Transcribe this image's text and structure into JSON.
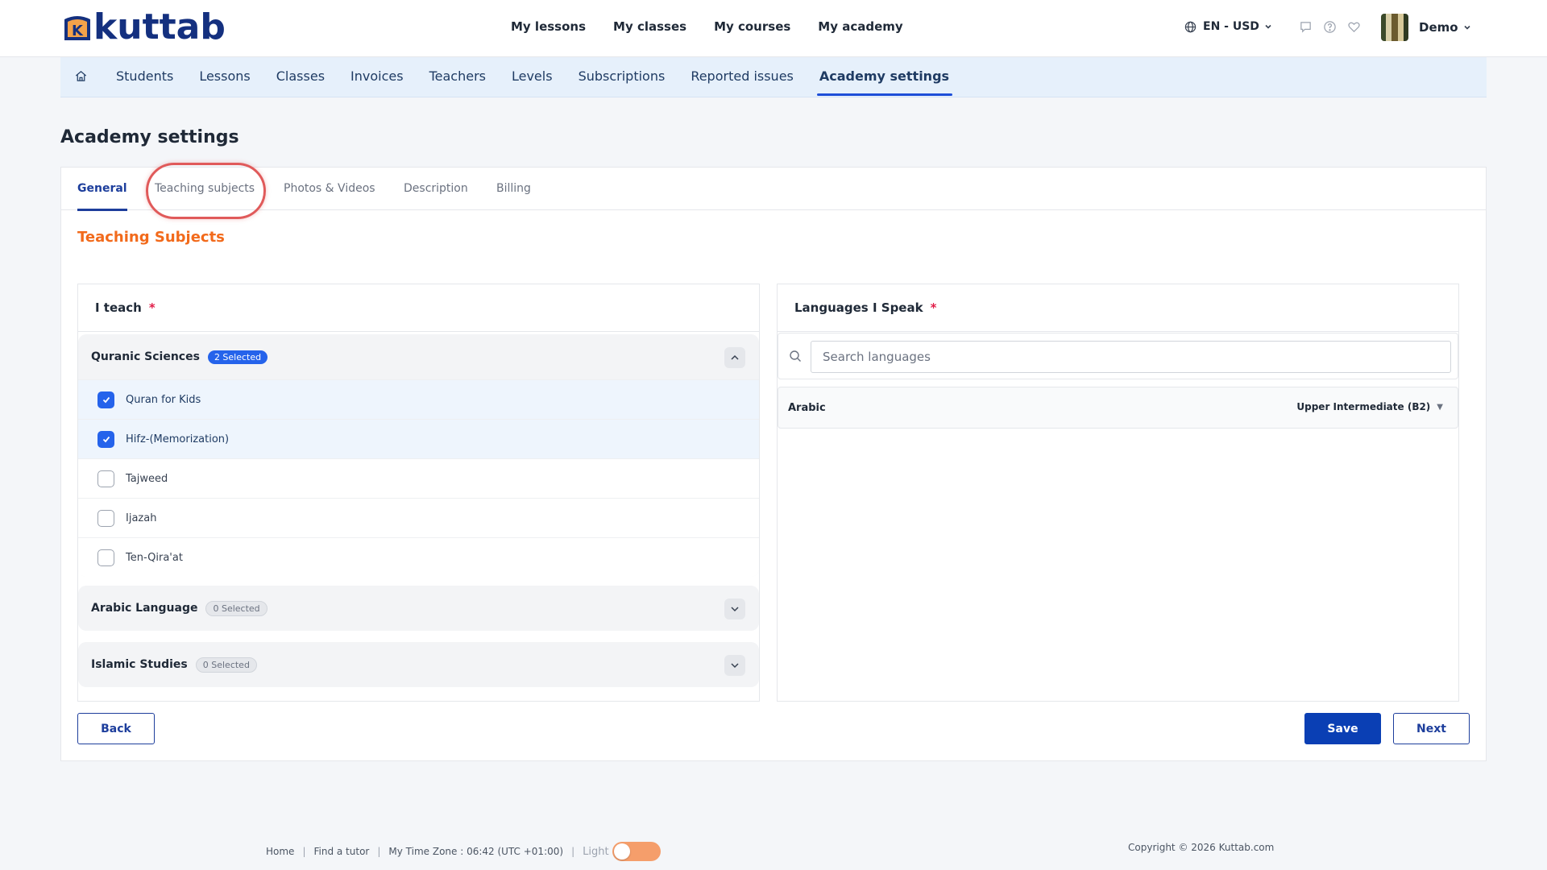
{
  "brand": {
    "name": "kuttab",
    "mark": "K",
    "color": "#14307f",
    "accent": "#f26a1b"
  },
  "topnav": {
    "items": [
      "My lessons",
      "My classes",
      "My courses",
      "My academy"
    ]
  },
  "locale": {
    "label": "EN - USD"
  },
  "header_icons": [
    "chat-icon",
    "help-icon",
    "heart-icon"
  ],
  "user": {
    "name": "Demo"
  },
  "subnav": {
    "items": [
      "Students",
      "Lessons",
      "Classes",
      "Invoices",
      "Teachers",
      "Levels",
      "Subscriptions",
      "Reported issues",
      "Academy settings"
    ],
    "active": "Academy settings"
  },
  "page": {
    "title": "Academy settings"
  },
  "tabs": {
    "items": [
      "General",
      "Teaching subjects",
      "Photos & Videos",
      "Description",
      "Billing"
    ],
    "active": "General",
    "highlighted": "Teaching subjects"
  },
  "section": {
    "title": "Teaching Subjects"
  },
  "teach": {
    "label": "I teach",
    "required_mark": "*",
    "groups": [
      {
        "name": "Quranic Sciences",
        "badge": "2 Selected",
        "expanded": true,
        "options": [
          {
            "label": "Quran for Kids",
            "checked": true
          },
          {
            "label": "Hifz-(Memorization)",
            "checked": true
          },
          {
            "label": "Tajweed",
            "checked": false
          },
          {
            "label": "Ijazah",
            "checked": false
          },
          {
            "label": "Ten-Qira'at",
            "checked": false
          }
        ]
      },
      {
        "name": "Arabic Language",
        "badge": "0 Selected",
        "expanded": false
      },
      {
        "name": "Islamic Studies",
        "badge": "0 Selected",
        "expanded": false
      }
    ]
  },
  "languages": {
    "label": "Languages I Speak",
    "required_mark": "*",
    "search_placeholder": "Search languages",
    "items": [
      {
        "name": "Arabic",
        "level": "Upper Intermediate (B2)"
      }
    ]
  },
  "buttons": {
    "back": "Back",
    "save": "Save",
    "next": "Next"
  },
  "footer": {
    "links": [
      "Home",
      "Find a tutor"
    ],
    "timezone": "My Time Zone : 06:42 (UTC +01:00)",
    "theme_label": "Light",
    "copyright": "Copyright © 2026 Kuttab.com"
  }
}
